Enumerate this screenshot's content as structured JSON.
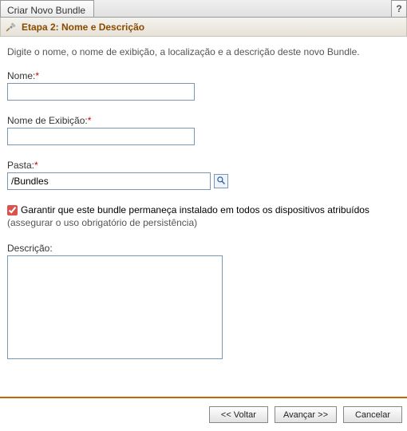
{
  "window": {
    "tab_title": "Criar Novo Bundle",
    "help_symbol": "?"
  },
  "step": {
    "title": "Etapa 2: Nome e Descrição"
  },
  "intro": "Digite o nome, o nome de exibição, a localização e a descrição deste novo Bundle.",
  "fields": {
    "name": {
      "label": "Nome:",
      "required": "*",
      "value": ""
    },
    "display_name": {
      "label": "Nome de Exibição:",
      "required": "*",
      "value": ""
    },
    "folder": {
      "label": "Pasta:",
      "required": "*",
      "value": "/Bundles"
    },
    "persist_checkbox": {
      "checked": true,
      "label": "Garantir que este bundle permaneça instalado em todos os dispositivos atribuídos",
      "note": "(assegurar o uso obrigatório de persistência)"
    },
    "description": {
      "label": "Descrição:",
      "value": ""
    }
  },
  "buttons": {
    "back": "<< Voltar",
    "next": "Avançar >>",
    "cancel": "Cancelar"
  },
  "icons": {
    "tools": "tools-icon",
    "browse": "magnifier-icon"
  }
}
